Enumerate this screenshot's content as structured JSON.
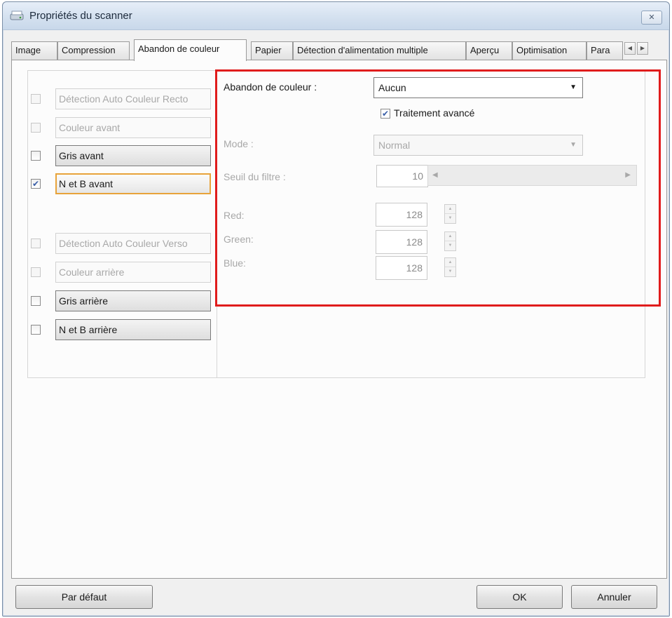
{
  "window": {
    "title": "Propriétés du scanner",
    "close_glyph": "✕"
  },
  "tabs": [
    {
      "label": "Image"
    },
    {
      "label": "Compression"
    },
    {
      "label": "Abandon de couleur",
      "active": true
    },
    {
      "label": "Papier"
    },
    {
      "label": "Détection d'alimentation multiple"
    },
    {
      "label": "Aperçu"
    },
    {
      "label": "Optimisation"
    },
    {
      "label": "Para"
    }
  ],
  "left_options": [
    {
      "label": "Détection Auto Couleur Recto",
      "checked": false,
      "enabled": false
    },
    {
      "label": "Couleur avant",
      "checked": false,
      "enabled": false
    },
    {
      "label": "Gris avant",
      "checked": false,
      "enabled": true
    },
    {
      "label": "N et B avant",
      "checked": true,
      "enabled": true,
      "focused": true
    },
    {
      "label": "Détection Auto Couleur Verso",
      "checked": false,
      "enabled": false
    },
    {
      "label": "Couleur arrière",
      "checked": false,
      "enabled": false
    },
    {
      "label": "Gris arrière",
      "checked": false,
      "enabled": true
    },
    {
      "label": "N et B arrière",
      "checked": false,
      "enabled": true
    }
  ],
  "settings": {
    "dropout_label": "Abandon de couleur :",
    "dropout_value": "Aucun",
    "advanced_label": "Traitement avancé",
    "advanced_checked": true,
    "mode_label": "Mode :",
    "mode_value": "Normal",
    "threshold_label": "Seuil du filtre :",
    "threshold_value": "10",
    "red_label": "Red:",
    "red_value": "128",
    "green_label": "Green:",
    "green_value": "128",
    "blue_label": "Blue:",
    "blue_value": "128"
  },
  "buttons": {
    "default": "Par défaut",
    "ok": "OK",
    "cancel": "Annuler"
  },
  "colors": {
    "highlight_box": "#e01c1c",
    "focus_border": "#e8a33a",
    "check_color": "#3a5fa8"
  }
}
